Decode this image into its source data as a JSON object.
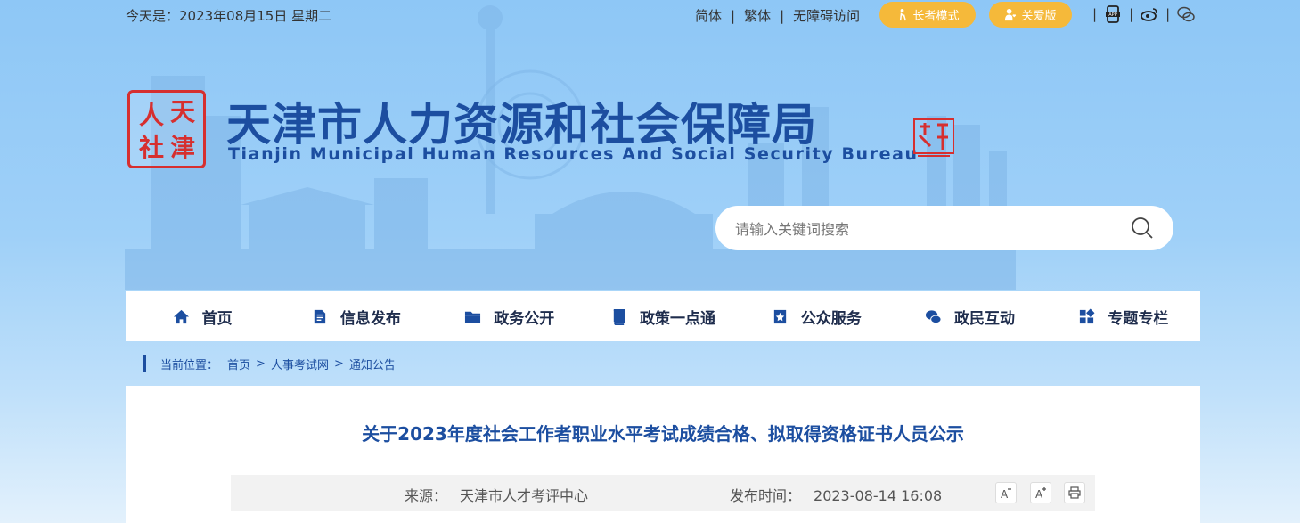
{
  "topbar": {
    "date": "今天是：2023年08月15日 星期二",
    "links": [
      "简体",
      "繁体",
      "无障碍访问"
    ],
    "elder_mode": "长者模式",
    "care_version": "关爱版"
  },
  "header": {
    "seal_chars": [
      "天",
      "人",
      "津",
      "社"
    ],
    "title_cn": "天津市人力资源和社会保障局",
    "title_en": "Tianjin Municipal Human Resources And Social Security Bureau"
  },
  "search": {
    "placeholder": "请输入关键词搜索"
  },
  "nav": {
    "items": [
      {
        "label": "首页",
        "icon": "home-icon"
      },
      {
        "label": "信息发布",
        "icon": "document-icon"
      },
      {
        "label": "政务公开",
        "icon": "folder-icon"
      },
      {
        "label": "政策一点通",
        "icon": "book-icon"
      },
      {
        "label": "公众服务",
        "icon": "service-icon"
      },
      {
        "label": "政民互动",
        "icon": "chat-icon"
      },
      {
        "label": "专题专栏",
        "icon": "grid-icon"
      }
    ]
  },
  "breadcrumb": {
    "label": "当前位置：",
    "items": [
      "首页",
      "人事考试网",
      "通知公告"
    ],
    "separator": ">"
  },
  "article": {
    "title": "关于2023年度社会工作者职业水平考试成绩合格、拟取得资格证书人员公示",
    "source_label": "来源：",
    "source": "天津市人才考评中心",
    "date_label": "发布时间：",
    "date": "2023-08-14 16:08"
  },
  "colors": {
    "brand": "#1c4ea0",
    "accent": "#f5b93a",
    "seal": "#d62f2f"
  }
}
